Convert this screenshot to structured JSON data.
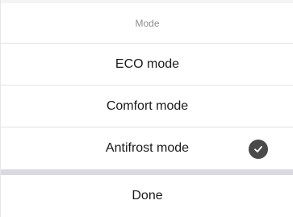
{
  "sheet": {
    "title": "Mode",
    "options": [
      {
        "label": "ECO mode",
        "selected": false
      },
      {
        "label": "Comfort mode",
        "selected": false
      },
      {
        "label": "Antifrost mode",
        "selected": true
      }
    ],
    "done_label": "Done"
  },
  "icons": {
    "selected": "checkmark-circle-icon"
  },
  "colors": {
    "check_fill": "#4a4a4a",
    "separator": "#d9d9df",
    "header_text": "#8e8e8e"
  }
}
